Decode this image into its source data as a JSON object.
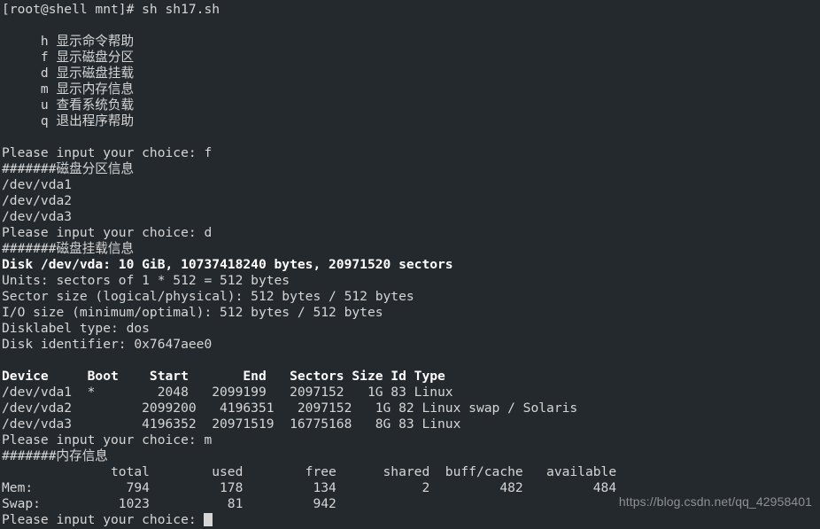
{
  "terminal": {
    "background_color": "#24292d",
    "foreground_color": "#d6d6d6",
    "bold_color": "#ffffff",
    "cursor_color": "#d6d6d6",
    "lines": [
      {
        "text": "[root@shell mnt]# sh sh17.sh",
        "bold": false
      },
      {
        "text": "",
        "bold": false
      },
      {
        "text": "     h 显示命令帮助",
        "bold": false
      },
      {
        "text": "     f 显示磁盘分区",
        "bold": false
      },
      {
        "text": "     d 显示磁盘挂载",
        "bold": false
      },
      {
        "text": "     m 显示内存信息",
        "bold": false
      },
      {
        "text": "     u 查看系统负载",
        "bold": false
      },
      {
        "text": "     q 退出程序帮助",
        "bold": false
      },
      {
        "text": "",
        "bold": false
      },
      {
        "text": "Please input your choice: f",
        "bold": false
      },
      {
        "text": "#######磁盘分区信息",
        "bold": false
      },
      {
        "text": "/dev/vda1",
        "bold": false
      },
      {
        "text": "/dev/vda2",
        "bold": false
      },
      {
        "text": "/dev/vda3",
        "bold": false
      },
      {
        "text": "Please input your choice: d",
        "bold": false
      },
      {
        "text": "#######磁盘挂载信息",
        "bold": false
      },
      {
        "text": "Disk /dev/vda: 10 GiB, 10737418240 bytes, 20971520 sectors",
        "bold": true
      },
      {
        "text": "Units: sectors of 1 * 512 = 512 bytes",
        "bold": false
      },
      {
        "text": "Sector size (logical/physical): 512 bytes / 512 bytes",
        "bold": false
      },
      {
        "text": "I/O size (minimum/optimal): 512 bytes / 512 bytes",
        "bold": false
      },
      {
        "text": "Disklabel type: dos",
        "bold": false
      },
      {
        "text": "Disk identifier: 0x7647aee0",
        "bold": false
      },
      {
        "text": "",
        "bold": false
      },
      {
        "text": "Device     Boot    Start       End   Sectors Size Id Type",
        "bold": true
      },
      {
        "text": "/dev/vda1  *        2048   2099199   2097152   1G 83 Linux",
        "bold": false
      },
      {
        "text": "/dev/vda2         2099200   4196351   2097152   1G 82 Linux swap / Solaris",
        "bold": false
      },
      {
        "text": "/dev/vda3         4196352  20971519  16775168   8G 83 Linux",
        "bold": false
      },
      {
        "text": "Please input your choice: m",
        "bold": false
      },
      {
        "text": "#######内存信息",
        "bold": false
      },
      {
        "text": "              total        used        free      shared  buff/cache   available",
        "bold": false
      },
      {
        "text": "Mem:            794         178         134           2         482         484",
        "bold": false
      },
      {
        "text": "Swap:          1023          81         942",
        "bold": false
      }
    ],
    "prompt_line": {
      "text": "Please input your choice: ",
      "cursor": "block-cursor"
    }
  },
  "watermark": {
    "text": "https://blog.csdn.net/qq_42958401"
  },
  "menu": {
    "title": "sh17.sh menu",
    "options": [
      {
        "key": "h",
        "label": "显示命令帮助"
      },
      {
        "key": "f",
        "label": "显示磁盘分区"
      },
      {
        "key": "d",
        "label": "显示磁盘挂载"
      },
      {
        "key": "m",
        "label": "显示内存信息"
      },
      {
        "key": "u",
        "label": "查看系统负载"
      },
      {
        "key": "q",
        "label": "退出程序帮助"
      }
    ]
  },
  "disk_partitions": {
    "header": "#######磁盘分区信息",
    "devices": [
      "/dev/vda1",
      "/dev/vda2",
      "/dev/vda3"
    ]
  },
  "disk_mount": {
    "header": "#######磁盘挂载信息",
    "disk_summary": "Disk /dev/vda: 10 GiB, 10737418240 bytes, 20971520 sectors",
    "units": "Units: sectors of 1 * 512 = 512 bytes",
    "sector_size": "Sector size (logical/physical): 512 bytes / 512 bytes",
    "io_size": "I/O size (minimum/optimal): 512 bytes / 512 bytes",
    "disklabel_type": "Disklabel type: dos",
    "disk_identifier": "Disk identifier: 0x7647aee0",
    "table_columns": [
      "Device",
      "Boot",
      "Start",
      "End",
      "Sectors",
      "Size",
      "Id",
      "Type"
    ],
    "table_rows": [
      {
        "device": "/dev/vda1",
        "boot": "*",
        "start": "2048",
        "end": "2099199",
        "sectors": "2097152",
        "size": "1G",
        "id": "83",
        "type": "Linux"
      },
      {
        "device": "/dev/vda2",
        "boot": "",
        "start": "2099200",
        "end": "4196351",
        "sectors": "2097152",
        "size": "1G",
        "id": "82",
        "type": "Linux swap / Solaris"
      },
      {
        "device": "/dev/vda3",
        "boot": "",
        "start": "4196352",
        "end": "20971519",
        "sectors": "16775168",
        "size": "8G",
        "id": "83",
        "type": "Linux"
      }
    ]
  },
  "memory_info": {
    "header": "#######内存信息",
    "columns": [
      "total",
      "used",
      "free",
      "shared",
      "buff/cache",
      "available"
    ],
    "rows": [
      {
        "label": "Mem:",
        "total": "794",
        "used": "178",
        "free": "134",
        "shared": "2",
        "buff_cache": "482",
        "available": "484"
      },
      {
        "label": "Swap:",
        "total": "1023",
        "used": "81",
        "free": "942",
        "shared": "",
        "buff_cache": "",
        "available": ""
      }
    ]
  },
  "prompts": {
    "choice_f": "Please input your choice: f",
    "choice_d": "Please input your choice: d",
    "choice_m": "Please input your choice: m",
    "choice_pending": "Please input your choice: "
  },
  "command": {
    "prompt": "[root@shell mnt]#",
    "invocation": "sh sh17.sh"
  }
}
